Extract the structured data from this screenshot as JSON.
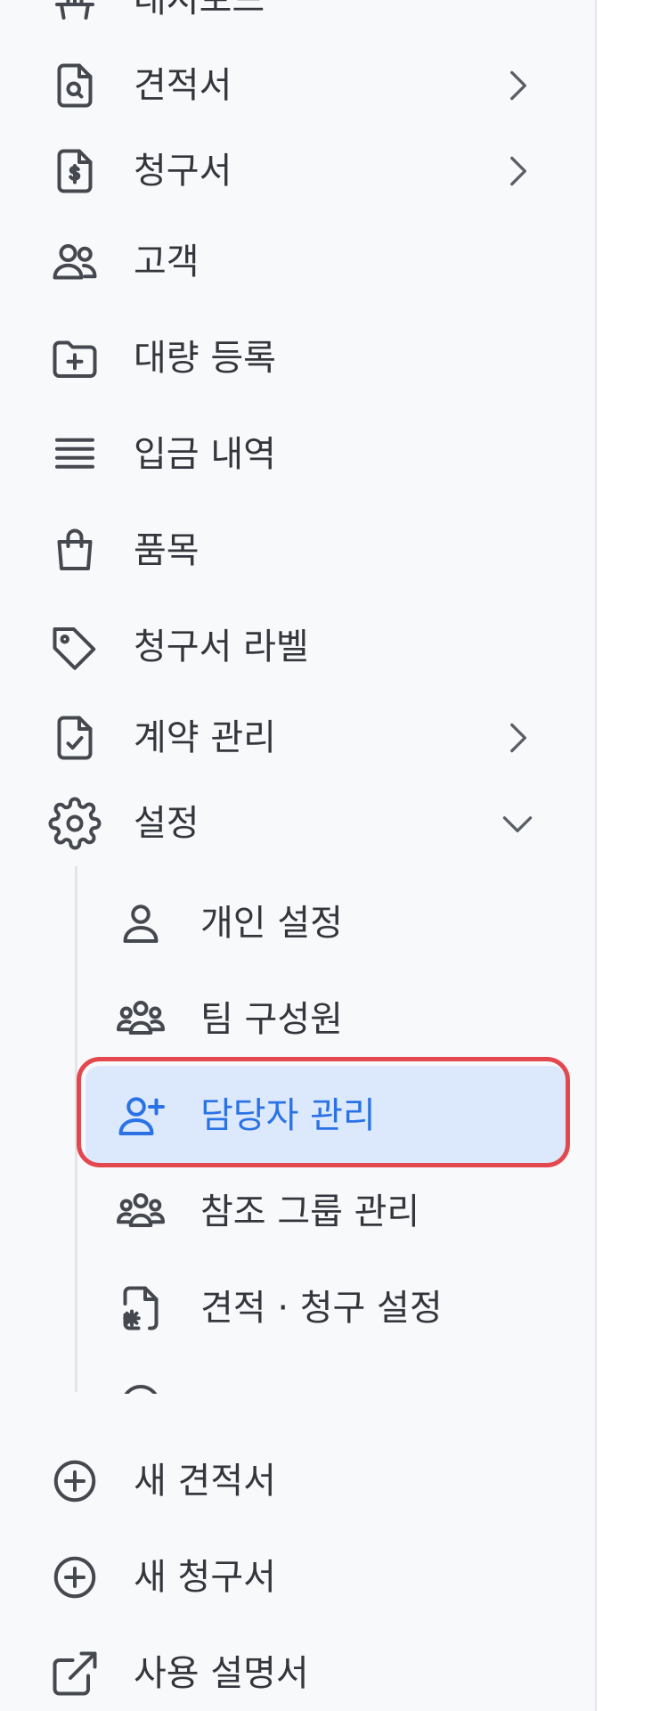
{
  "sidebar": {
    "items": [
      {
        "label": "대시보드",
        "icon": "chart-icon"
      },
      {
        "label": "견적서",
        "icon": "search-document-icon",
        "has_chevron": true
      },
      {
        "label": "청구서",
        "icon": "dollar-document-icon",
        "has_chevron": true
      },
      {
        "label": "고객",
        "icon": "users-icon"
      },
      {
        "label": "대량 등록",
        "icon": "folder-plus-icon"
      },
      {
        "label": "입금 내역",
        "icon": "list-icon"
      },
      {
        "label": "품목",
        "icon": "shopping-bag-icon"
      },
      {
        "label": "청구서 라벨",
        "icon": "tag-icon"
      },
      {
        "label": "계약 관리",
        "icon": "document-check-icon",
        "has_chevron": true
      },
      {
        "label": "설정",
        "icon": "gear-icon",
        "expanded": true
      }
    ],
    "settings_sub": [
      {
        "label": "개인 설정",
        "icon": "user-icon"
      },
      {
        "label": "팀 구성원",
        "icon": "team-icon"
      },
      {
        "label": "담당자 관리",
        "icon": "user-plus-icon",
        "active": true
      },
      {
        "label": "참조 그룹 관리",
        "icon": "team-icon"
      },
      {
        "label": "견적 · 청구 설정",
        "icon": "document-gear-icon"
      }
    ],
    "bottom": [
      {
        "label": "새 견적서",
        "icon": "plus-circle-icon"
      },
      {
        "label": "새 청구서",
        "icon": "plus-circle-icon"
      },
      {
        "label": "사용 설명서",
        "icon": "external-link-icon"
      }
    ],
    "colors": {
      "active_text": "#2a72e6",
      "active_bg": "#dce9fd",
      "highlight_ring": "#e2484e"
    }
  }
}
